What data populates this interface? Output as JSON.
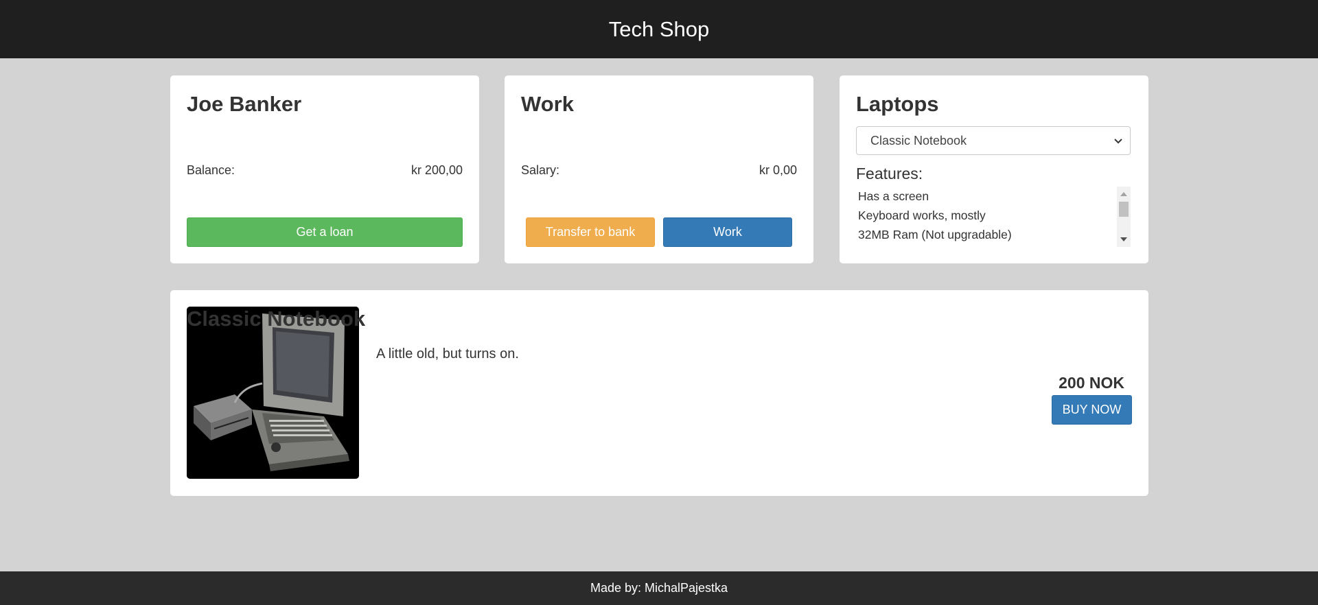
{
  "header": {
    "title": "Tech Shop"
  },
  "bank": {
    "name": "Joe Banker",
    "balance_label": "Balance:",
    "balance_value": "kr 200,00",
    "loan_button": "Get a loan"
  },
  "work": {
    "title": "Work",
    "salary_label": "Salary:",
    "salary_value": "kr 0,00",
    "transfer_button": "Transfer to bank",
    "work_button": "Work"
  },
  "laptops": {
    "title": "Laptops",
    "selected": "Classic Notebook",
    "features_label": "Features:",
    "features": [
      "Has a screen",
      "Keyboard works, mostly",
      "32MB Ram (Not upgradable)"
    ]
  },
  "product": {
    "title": "Classic Notebook",
    "description": "A little old, but turns on.",
    "price": "200 NOK",
    "buy_button": "BUY NOW"
  },
  "footer": {
    "text": "Made by: MichalPajestka"
  },
  "colors": {
    "header_bg": "#1f1f1f",
    "page_bg": "#d3d3d3",
    "success": "#5cb85c",
    "warning": "#f0ad4e",
    "primary": "#337ab7",
    "footer_bg": "#2b2b2b"
  },
  "icons": {
    "select_chevron": "chevron-down-icon",
    "scroll_up": "arrow-up-icon",
    "scroll_down": "arrow-down-icon"
  }
}
